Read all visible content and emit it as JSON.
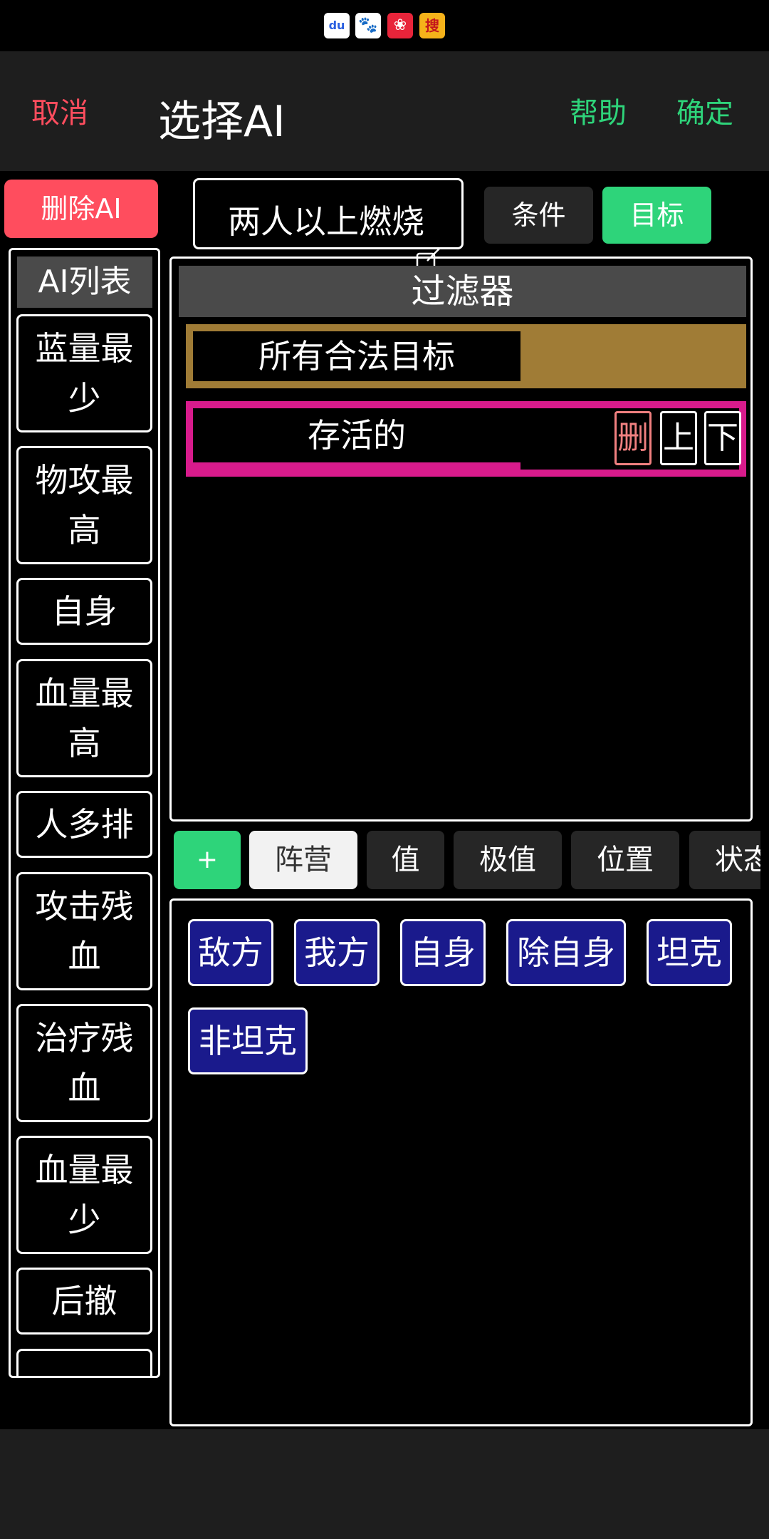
{
  "status_bar": {
    "icons": [
      "baidu-icon",
      "paw-app-icon",
      "red-app-icon",
      "sohu-app-icon"
    ],
    "icon_text": [
      "du",
      "🐾",
      "❀",
      "搜"
    ]
  },
  "header": {
    "cancel": "取消",
    "title": "选择AI",
    "help": "帮助",
    "confirm": "确定"
  },
  "delete_ai": "删除AI",
  "name_input": {
    "value": "两人以上燃烧"
  },
  "mode_tabs": {
    "condition": "条件",
    "target": "目标",
    "active": "target"
  },
  "ai_list": {
    "header": "AI列表",
    "items": [
      "蓝量最少",
      "物攻最高",
      "自身",
      "血量最高",
      "人多排",
      "攻击残血",
      "治疗残血",
      "血量最少",
      "后撤"
    ]
  },
  "filter": {
    "header": "过滤器",
    "rules": [
      {
        "label": "所有合法目标"
      },
      {
        "label": "存活的",
        "delete": "删",
        "up": "上",
        "down": "下"
      }
    ]
  },
  "categories": {
    "add": "+",
    "items": [
      "阵营",
      "值",
      "极值",
      "位置",
      "状态"
    ],
    "selected": "阵营"
  },
  "options": [
    "敌方",
    "我方",
    "自身",
    "除自身",
    "坦克",
    "非坦克"
  ],
  "colors": {
    "accent_green": "#2ed47a",
    "danger_red": "#ff4d5e",
    "rule_gold": "#a07c36",
    "rule_pink": "#d81b8c",
    "option_blue": "#1a1a8c"
  }
}
